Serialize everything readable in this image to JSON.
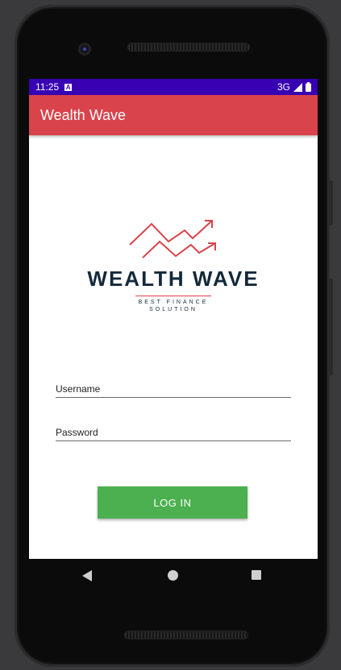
{
  "status_bar": {
    "time": "11:25",
    "network": "3G"
  },
  "app_bar": {
    "title": "Wealth Wave"
  },
  "logo": {
    "name": "WEALTH WAVE",
    "tagline_line1": "BEST FINANCE",
    "tagline_line2": "SOLUTION"
  },
  "form": {
    "username_placeholder": "Username",
    "password_placeholder": "Password",
    "login_label": "LOG IN"
  },
  "colors": {
    "status_bar": "#3700b3",
    "app_bar": "#d9434b",
    "login_button": "#4caf50",
    "logo_text": "#14293a"
  }
}
